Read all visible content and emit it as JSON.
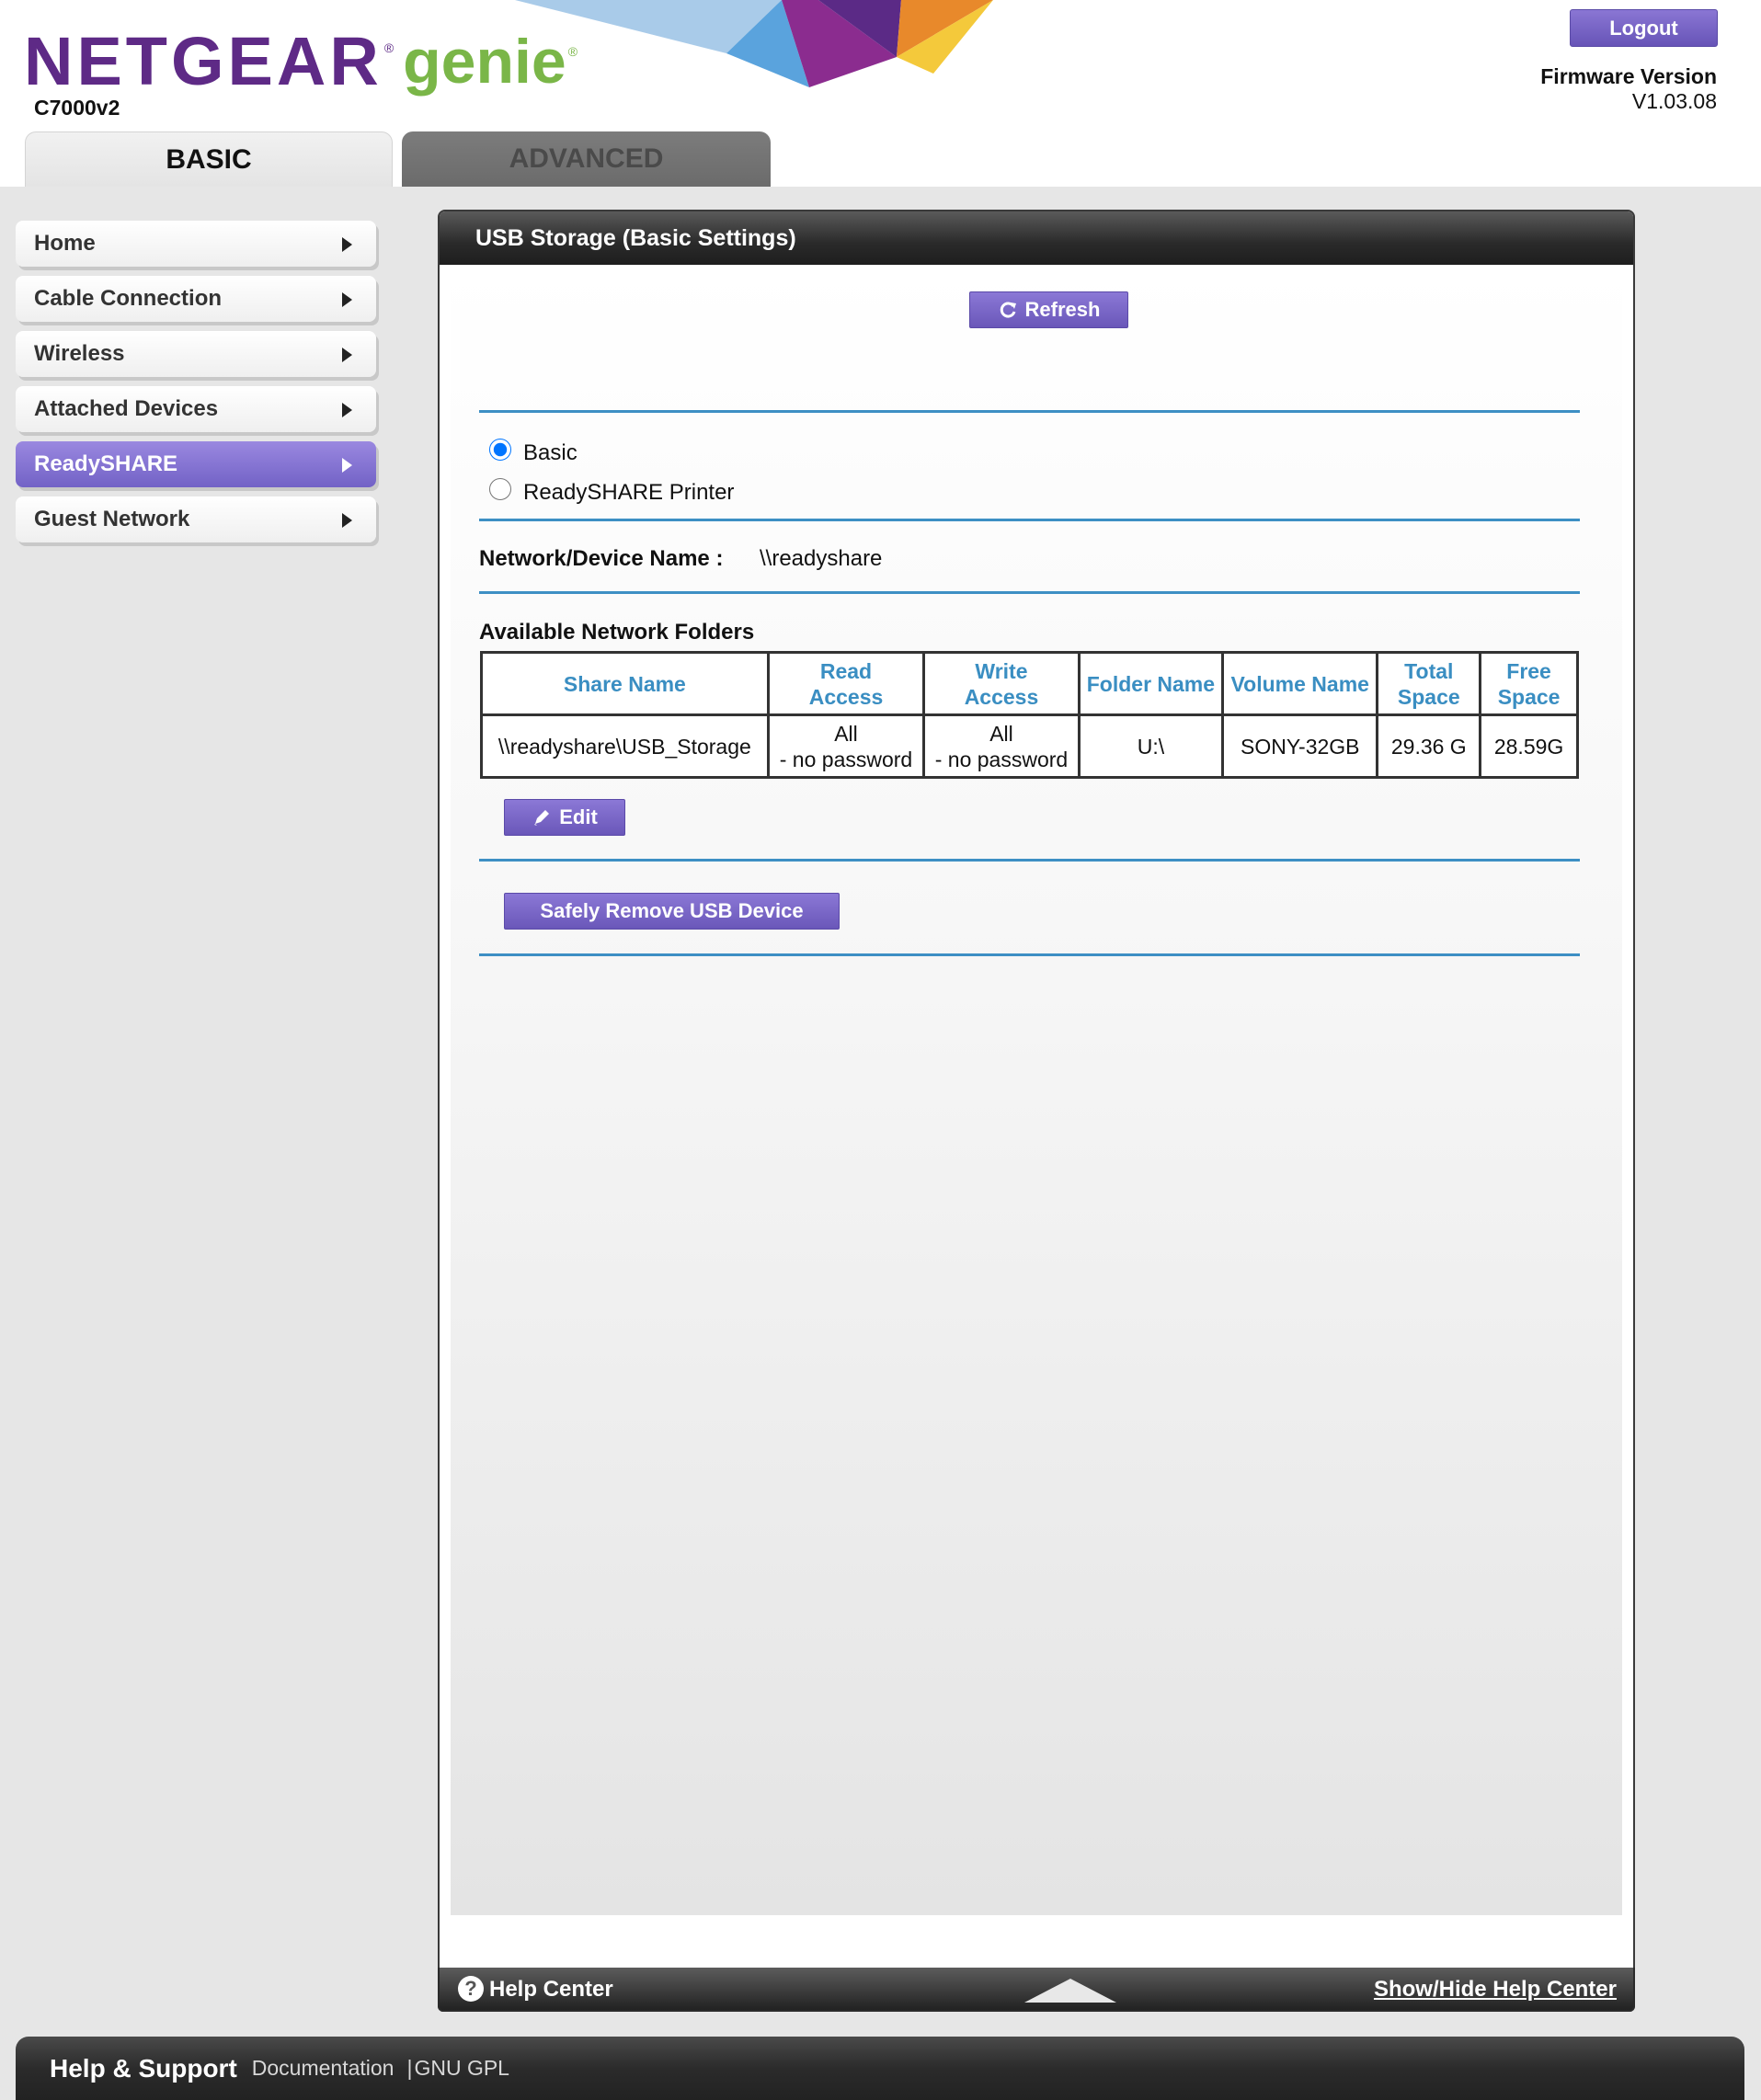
{
  "header": {
    "brand": "NETGEAR",
    "brand_reg": "®",
    "product": "genie",
    "product_reg": "®",
    "model": "C7000v2",
    "logout_label": "Logout",
    "firmware_label": "Firmware Version",
    "firmware_value": "V1.03.08"
  },
  "tabs": [
    {
      "label": "BASIC",
      "active": true
    },
    {
      "label": "ADVANCED",
      "active": false
    }
  ],
  "sidebar": {
    "items": [
      {
        "label": "Home"
      },
      {
        "label": "Cable Connection"
      },
      {
        "label": "Wireless"
      },
      {
        "label": "Attached Devices"
      },
      {
        "label": "ReadySHARE",
        "active": true
      },
      {
        "label": "Guest Network"
      }
    ]
  },
  "panel": {
    "title": "USB Storage (Basic Settings)",
    "refresh_label": "Refresh",
    "mode_options": [
      {
        "label": "Basic",
        "checked": true
      },
      {
        "label": "ReadySHARE Printer",
        "checked": false
      }
    ],
    "device_name_label": "Network/Device Name :",
    "device_name_value": "\\\\readyshare",
    "folders_title": "Available Network Folders",
    "table": {
      "headers": [
        "Share Name",
        "Read Access",
        "Write Access",
        "Folder Name",
        "Volume Name",
        "Total Space",
        "Free Space"
      ],
      "header_lines": [
        [
          "Share Name"
        ],
        [
          "Read",
          "Access"
        ],
        [
          "Write",
          "Access"
        ],
        [
          "Folder Name"
        ],
        [
          "Volume Name"
        ],
        [
          "Total",
          "Space"
        ],
        [
          "Free",
          "Space"
        ]
      ],
      "rows": [
        {
          "share_name": "\\\\readyshare\\USB_Storage",
          "read_access": [
            "All",
            "- no password"
          ],
          "write_access": [
            "All",
            "- no password"
          ],
          "folder_name": "U:\\",
          "volume_name": "SONY-32GB",
          "total_space": "29.36 G",
          "free_space": "28.59G"
        }
      ]
    },
    "edit_label": "Edit",
    "safely_remove_label": "Safely Remove USB Device"
  },
  "help_center": {
    "title": "Help Center",
    "toggle_label": "Show/Hide Help Center"
  },
  "footer": {
    "title": "Help & Support",
    "links": [
      "Documentation",
      "GNU GPL"
    ],
    "separator": "|"
  },
  "colors": {
    "accent_purple": "#6a57b9",
    "brand_purple": "#5e2a86",
    "brand_green": "#7ab648",
    "rule_blue": "#3d8fc4",
    "table_header_blue": "#3a8ec2"
  }
}
